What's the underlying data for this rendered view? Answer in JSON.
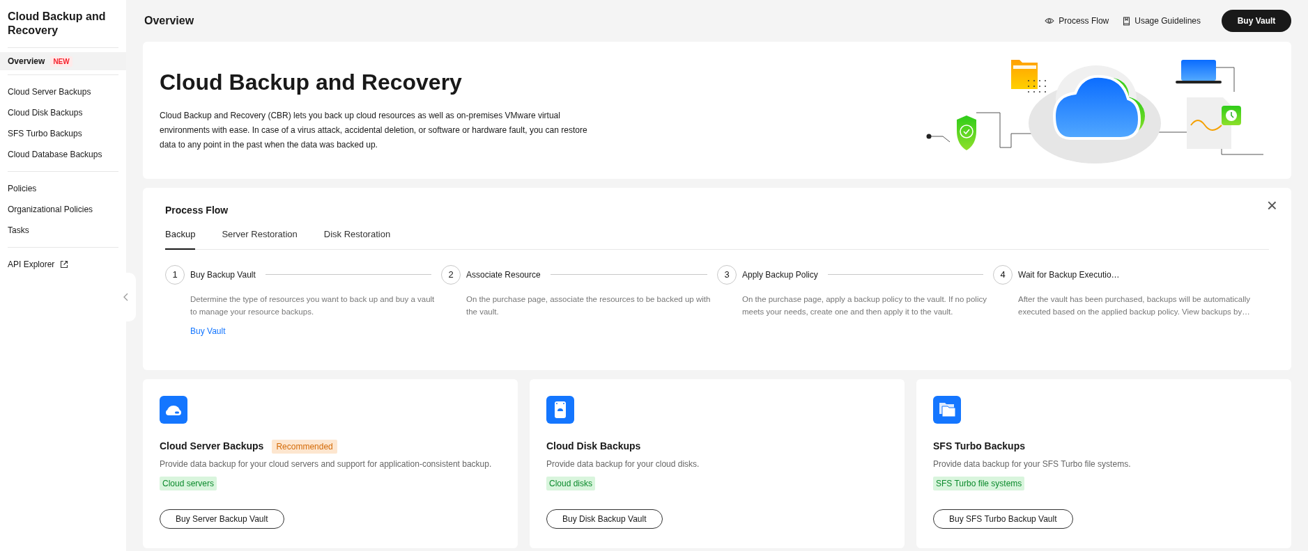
{
  "sidebar": {
    "title": "Cloud Backup and Recovery",
    "groups": [
      [
        {
          "label": "Overview",
          "badge": "NEW",
          "selected": true
        }
      ],
      [
        {
          "label": "Cloud Server Backups",
          "selected": false
        },
        {
          "label": "Cloud Disk Backups",
          "selected": false
        },
        {
          "label": "SFS Turbo Backups",
          "selected": false
        },
        {
          "label": "Cloud Database Backups",
          "selected": false
        }
      ],
      [
        {
          "label": "Policies",
          "selected": false
        },
        {
          "label": "Organizational Policies",
          "selected": false
        },
        {
          "label": "Tasks",
          "selected": false
        }
      ],
      [
        {
          "label": "API Explorer",
          "external": true,
          "selected": false
        }
      ]
    ]
  },
  "header": {
    "title": "Overview",
    "actions": [
      {
        "kind": "eye",
        "label": "Process Flow"
      },
      {
        "kind": "book",
        "label": "Usage Guidelines"
      },
      {
        "kind": "primary",
        "label": "Buy Vault"
      }
    ]
  },
  "hero": {
    "title": "Cloud Backup and Recovery",
    "description": "Cloud Backup and Recovery (CBR) lets you back up cloud resources as well as on-premises VMware virtual environments with ease. In case of a virus attack, accidental deletion, or software or hardware fault, you can restore data to any point in the past when the data was backed up."
  },
  "process_flow": {
    "title": "Process Flow",
    "close": "×",
    "tabs": [
      {
        "label": "Backup",
        "selected": true
      },
      {
        "label": "Server Restoration",
        "selected": false
      },
      {
        "label": "Disk Restoration",
        "selected": false
      }
    ],
    "steps": [
      {
        "number": "1",
        "title": "Buy Backup Vault",
        "description": "Determine the type of resources you want to back up and buy a vault to manage your resource backups.",
        "link": "Buy Vault"
      },
      {
        "number": "2",
        "title": "Associate Resource",
        "description": "On the purchase page, associate the resources to be backed up with the vault."
      },
      {
        "number": "3",
        "title": "Apply Backup Policy",
        "description": "On the purchase page, apply a backup policy to the vault. If no policy meets your needs, create one and then apply it to the vault."
      },
      {
        "number": "4",
        "title": "Wait for Backup Executio…",
        "description": "After the vault has been purchased, backups will be automatically executed based on the applied backup policy. View backups by…"
      }
    ]
  },
  "cards": [
    {
      "kind": "server",
      "title": "Cloud Server Backups",
      "badge": "Recommended",
      "description": "Provide data backup for your cloud servers and support for application-consistent backup.",
      "tag": "Cloud servers",
      "button": "Buy Server Backup Vault"
    },
    {
      "kind": "disk",
      "title": "Cloud Disk Backups",
      "description": "Provide data backup for your cloud disks.",
      "tag": "Cloud disks",
      "button": "Buy Disk Backup Vault"
    },
    {
      "kind": "folders",
      "title": "SFS Turbo Backups",
      "description": "Provide data backup for your SFS Turbo file systems.",
      "tag": "SFS Turbo file systems",
      "button": "Buy SFS Turbo Backup Vault"
    }
  ]
}
